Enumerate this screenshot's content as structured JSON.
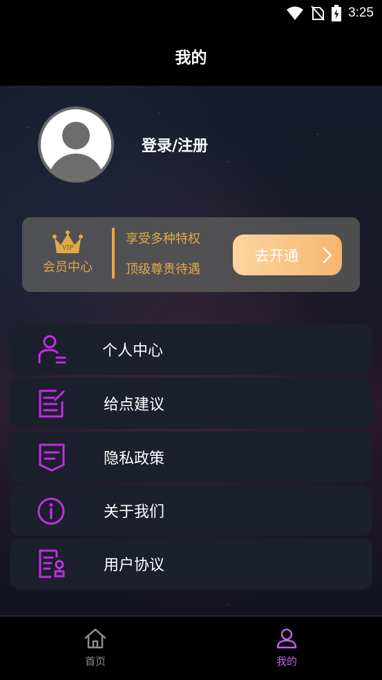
{
  "status_bar": {
    "time": "3:25",
    "icons": [
      "wifi-icon",
      "no-sim-icon",
      "battery-charging-icon"
    ]
  },
  "header": {
    "title": "我的"
  },
  "profile": {
    "login_label": "登录/注册",
    "avatar_icon": "default-avatar-icon"
  },
  "vip": {
    "label": "会员中心",
    "badge_text": "VIP",
    "perks": [
      "享受多种特权",
      "顶级尊贵待遇"
    ],
    "button_label": "去开通",
    "accent_color": "#e0a94a"
  },
  "menu": {
    "items": [
      {
        "label": "个人中心",
        "icon": "user-profile-icon"
      },
      {
        "label": "给点建议",
        "icon": "edit-note-icon"
      },
      {
        "label": "隐私政策",
        "icon": "message-doc-icon"
      },
      {
        "label": "关于我们",
        "icon": "info-icon"
      },
      {
        "label": "用户协议",
        "icon": "agreement-stamp-icon"
      }
    ],
    "icon_color": "#c22ee6"
  },
  "tabbar": {
    "tabs": [
      {
        "label": "首页",
        "icon": "home-icon",
        "active": false
      },
      {
        "label": "我的",
        "icon": "user-icon",
        "active": true
      }
    ],
    "active_color": "#c561e8"
  }
}
